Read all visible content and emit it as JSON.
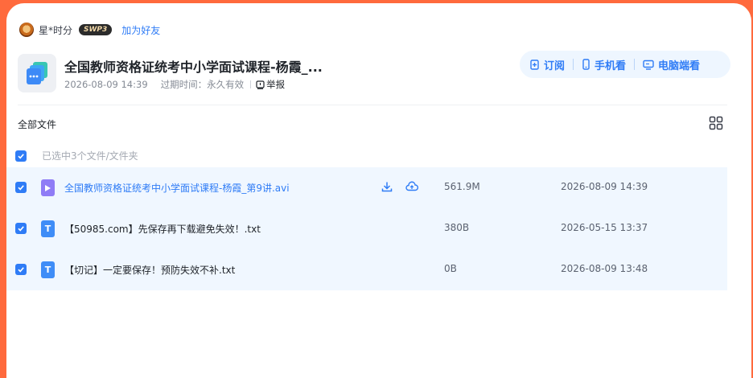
{
  "sharer": {
    "name": "星*时分",
    "badge": "SWP3",
    "add_friend": "加为好友"
  },
  "share": {
    "title": "全国教师资格证统考中小学面试课程-杨霞_...",
    "date": "2026-08-09 14:39",
    "expire_label": "过期时间：",
    "expire_value": "永久有效",
    "report": "举报"
  },
  "actions": {
    "subscribe": "订阅",
    "mobile": "手机看",
    "desktop": "电脑端看"
  },
  "breadcrumb": "全部文件",
  "selection_text": "已选中3个文件/文件夹",
  "files": [
    {
      "name": "全国教师资格证统考中小学面试课程-杨霞_第9讲.avi",
      "type": "video",
      "icon_text": "",
      "size": "561.9M",
      "date": "2026-08-09 14:39",
      "checked": true
    },
    {
      "name": "【50985.com】先保存再下载避免失效！.txt",
      "type": "txt",
      "icon_text": "T",
      "size": "380B",
      "date": "2026-05-15 13:37",
      "checked": true
    },
    {
      "name": "【切记】一定要保存！预防失效不补.txt",
      "type": "txt",
      "icon_text": "T",
      "size": "0B",
      "date": "2026-08-09 13:48",
      "checked": true
    }
  ],
  "colors": {
    "accent": "#2f7cf6",
    "background": "#ff6a3d",
    "row_highlight": "#f0f7ff"
  },
  "icons": [
    "avatar",
    "folder-stack-icon",
    "report-icon",
    "subscribe-icon",
    "mobile-icon",
    "desktop-icon",
    "grid-view-icon",
    "checkbox-icon",
    "video-file-icon",
    "text-file-icon",
    "download-icon",
    "cloud-save-icon"
  ]
}
